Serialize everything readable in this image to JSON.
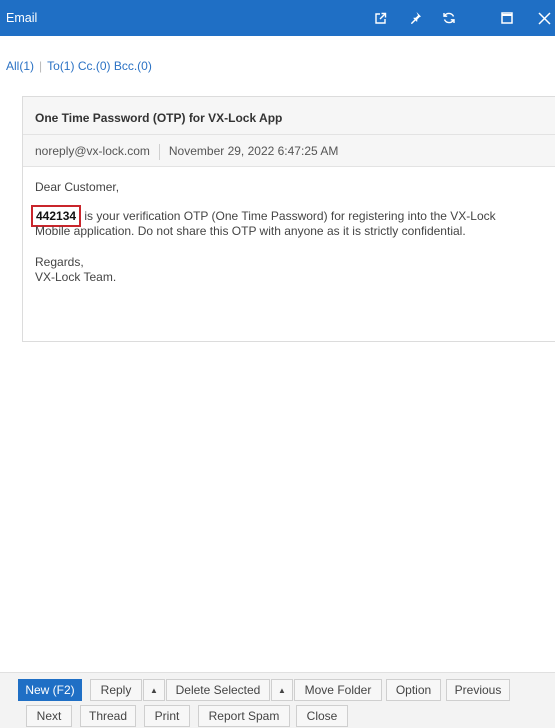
{
  "window": {
    "title": "Email"
  },
  "filters": {
    "all": "All(1)",
    "to": "To(1)",
    "cc": "Cc.(0)",
    "bcc": "Bcc.(0)"
  },
  "email": {
    "subject": "One Time Password (OTP) for VX-Lock App",
    "from": "noreply@vx-lock.com",
    "date": "November 29, 2022 6:47:25 AM",
    "greeting": "Dear Customer,",
    "otp_code": "442134",
    "message_line1": " is your verification OTP (One Time Password) for registering into the VX-Lock",
    "message_line2": "Mobile application. Do not share this OTP with anyone as it is strictly confidential.",
    "closing": "Regards,",
    "signature": "VX-Lock Team."
  },
  "toolbar": {
    "new": "New (F2)",
    "reply": "Reply",
    "reply_arrow": "▲",
    "delete_selected": "Delete Selected",
    "delete_arrow": "▲",
    "move_folder": "Move Folder",
    "option": "Option",
    "previous": "Previous",
    "next": "Next",
    "thread": "Thread",
    "print": "Print",
    "report_spam": "Report Spam",
    "close": "Close"
  },
  "colors": {
    "accent": "#1f6fc5",
    "otp_highlight": "#c9252b"
  }
}
